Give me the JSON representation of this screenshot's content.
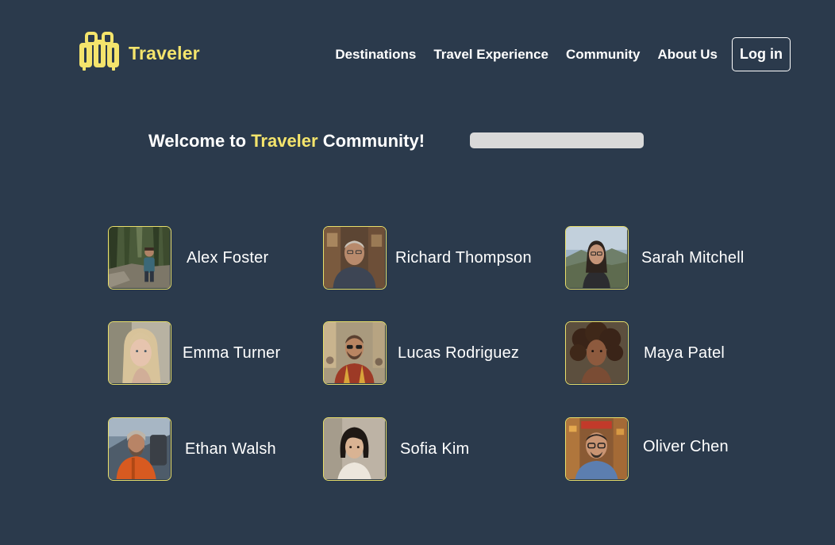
{
  "colors": {
    "background": "#2b3a4c",
    "accent": "#f4e46c",
    "text": "#ffffff",
    "search_bar": "#d9d9d9",
    "avatar_border": "#e9df6a"
  },
  "brand": {
    "name": "Traveler",
    "icon": "luggage-icon"
  },
  "nav": {
    "items": [
      {
        "label": "Destinations"
      },
      {
        "label": "Travel Experience"
      },
      {
        "label": "Community"
      },
      {
        "label": "About Us"
      }
    ],
    "login_label": "Log in"
  },
  "welcome": {
    "prefix": "Welcome to ",
    "brand": "Traveler",
    "suffix": " Community!"
  },
  "search": {
    "placeholder": "",
    "value": ""
  },
  "members": [
    {
      "name": "Alex Foster",
      "avatar": "hiker-forest-photo"
    },
    {
      "name": "Richard Thompson",
      "avatar": "older-man-portrait"
    },
    {
      "name": "Sarah Mitchell",
      "avatar": "woman-mountain-view-photo"
    },
    {
      "name": "Emma Turner",
      "avatar": "blonde-woman-portrait"
    },
    {
      "name": "Lucas Rodriguez",
      "avatar": "man-sunglasses-market-photo"
    },
    {
      "name": "Maya Patel",
      "avatar": "curly-hair-woman-portrait"
    },
    {
      "name": "Ethan Walsh",
      "avatar": "mountaineer-orange-jacket-photo"
    },
    {
      "name": "Sofia Kim",
      "avatar": "short-hair-woman-portrait"
    },
    {
      "name": "Oliver Chen",
      "avatar": "man-glasses-city-photo"
    }
  ]
}
